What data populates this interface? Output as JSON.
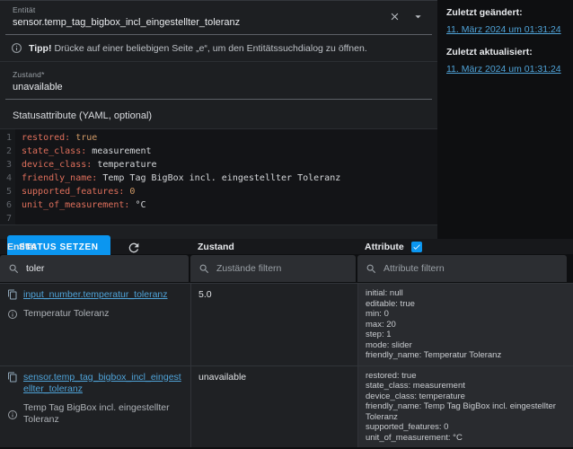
{
  "meta_panel": {
    "last_changed_label": "Zuletzt geändert:",
    "last_changed_value": "11. März 2024 um 01:31:24",
    "last_updated_label": "Zuletzt aktualisiert:",
    "last_updated_value": "11. März 2024 um 01:31:24"
  },
  "editor_panel": {
    "entity_field": {
      "label": "Entität",
      "value": "sensor.temp_tag_bigbox_incl_eingestellter_toleranz"
    },
    "tip": {
      "bold": "Tipp!",
      "text": "Drücke auf einer beliebigen Seite „e“, um den Entitätssuchdialog zu öffnen."
    },
    "state_field": {
      "label": "Zustand*",
      "value": "unavailable"
    },
    "attributes_label": "Statusattribute (YAML, optional)",
    "yaml": {
      "lines": [
        {
          "num": "1",
          "key": "restored:",
          "value": "true"
        },
        {
          "num": "2",
          "key": "state_class:",
          "value": "measurement"
        },
        {
          "num": "3",
          "key": "device_class:",
          "value": "temperature"
        },
        {
          "num": "4",
          "key": "friendly_name:",
          "value": "Temp Tag BigBox incl. eingestellter Toleranz"
        },
        {
          "num": "5",
          "key": "supported_features:",
          "value": "0"
        },
        {
          "num": "6",
          "key": "unit_of_measurement:",
          "value": "°C"
        },
        {
          "num": "7",
          "key": "",
          "value": ""
        }
      ]
    },
    "set_state_button": "STATUS SETZEN"
  },
  "table": {
    "headers": {
      "entity": "Entität",
      "state": "Zustand",
      "attributes": "Attribute"
    },
    "attributes_checkbox_checked": true,
    "filters": {
      "entity_value": "toler",
      "state_placeholder": "Zustände filtern",
      "attributes_placeholder": "Attribute filtern"
    },
    "rows": [
      {
        "entity_id": "input_number.temperatur_toleranz",
        "friendly_name": "Temperatur Toleranz",
        "state": "5.0",
        "attributes": [
          "initial: null",
          "editable: true",
          "min: 0",
          "max: 20",
          "step: 1",
          "mode: slider",
          "friendly_name: Temperatur Toleranz"
        ]
      },
      {
        "entity_id": "sensor.temp_tag_bigbox_incl_eingestellter_toleranz",
        "friendly_name": "Temp Tag BigBox incl. eingestellter Toleranz",
        "state": "unavailable",
        "attributes": [
          "restored: true",
          "state_class: measurement",
          "device_class: temperature",
          "friendly_name: Temp Tag BigBox incl. eingestellter Toleranz",
          "supported_features: 0",
          "unit_of_measurement: °C"
        ]
      }
    ]
  },
  "icons": {
    "clear": "x-mark",
    "dropdown": "caret-down",
    "info": "info-circle",
    "search": "magnifier",
    "copy": "content-copy",
    "refresh": "circular-arrow",
    "checkbox_check": "check-mark"
  },
  "colors": {
    "accent": "#0b96f0",
    "link": "#4fa3d8",
    "yaml_key": "#e0705c",
    "yaml_atom": "#d19a66"
  }
}
